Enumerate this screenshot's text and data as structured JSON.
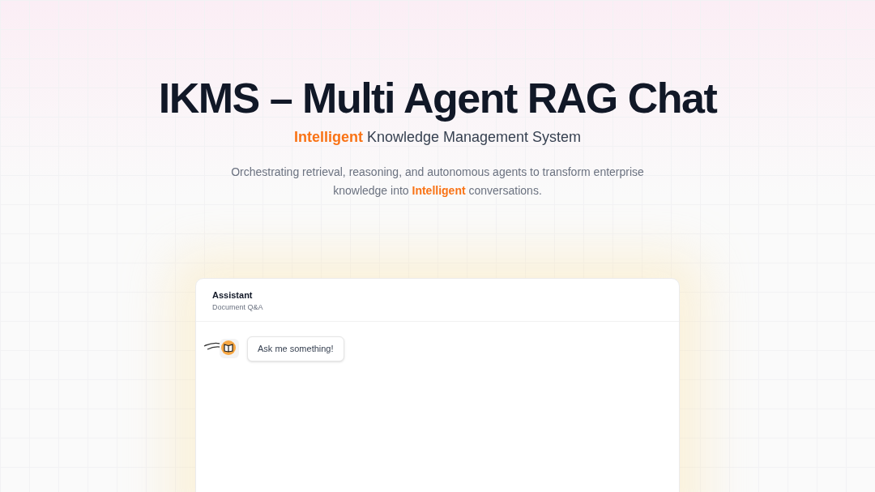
{
  "hero": {
    "title": "IKMS – Multi Agent RAG Chat",
    "subtitle": [
      {
        "text": "Intelligent",
        "highlight": true
      },
      {
        "text": " Knowledge Management System",
        "highlight": false
      }
    ],
    "description": [
      {
        "text": "Orchestrating retrieval, reasoning, and autonomous agents to transform enterprise knowledge into ",
        "highlight": false
      },
      {
        "text": "Intelligent",
        "highlight": true
      },
      {
        "text": " conversations.",
        "highlight": false
      }
    ]
  },
  "chat": {
    "title": "Assistant",
    "subtitle": "Document Q&A",
    "messages": [
      {
        "kind": "assistant",
        "text": "Ask me something!"
      }
    ]
  }
}
